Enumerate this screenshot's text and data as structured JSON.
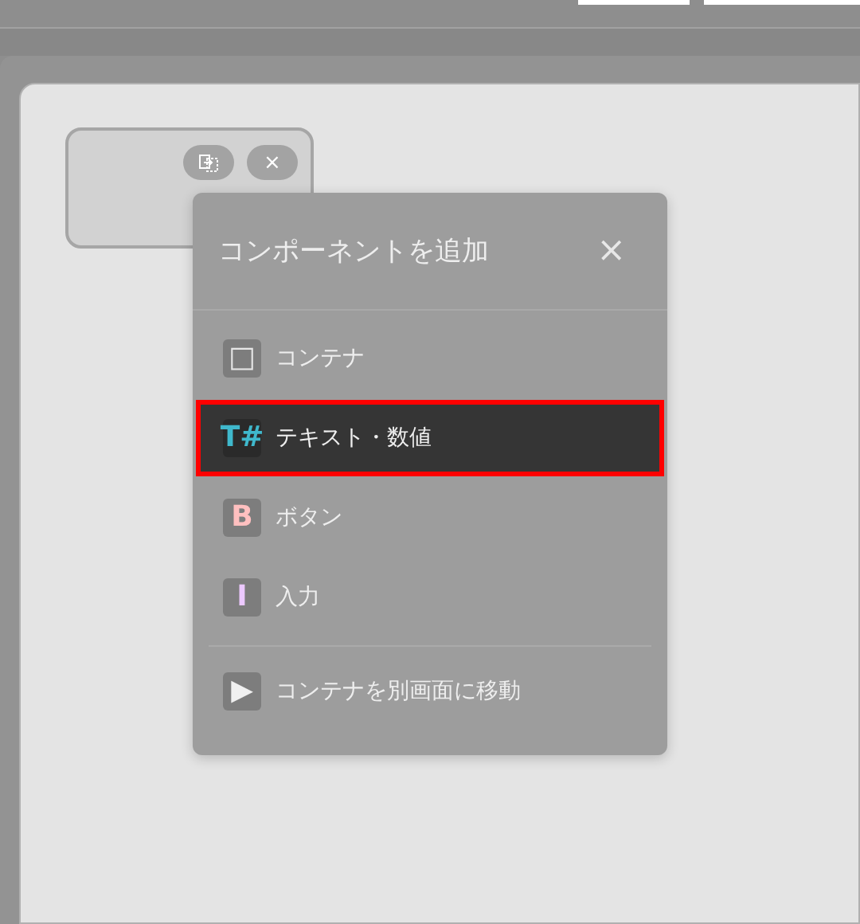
{
  "card": {
    "buttons": [
      {
        "kind": "move"
      },
      {
        "kind": "close",
        "label": "×"
      }
    ]
  },
  "menu": {
    "title": "コンポーネントを追加",
    "close": "×",
    "items": [
      {
        "icon": "□",
        "label": "コンテナ",
        "color": "#e6e6e6",
        "selected": false
      },
      {
        "icon": "T#",
        "label": "テキスト・数値",
        "color": "#3fb8cc",
        "selected": true
      },
      {
        "icon": "B",
        "label": "ボタン",
        "color": "#ffc0c0",
        "selected": false
      },
      {
        "icon": "I",
        "label": "入力",
        "color": "#ecc8ff",
        "selected": false
      }
    ],
    "footer_item": {
      "icon": "▶",
      "label": "コンテナを別画面に移動",
      "color": "#f0f0f0"
    }
  }
}
